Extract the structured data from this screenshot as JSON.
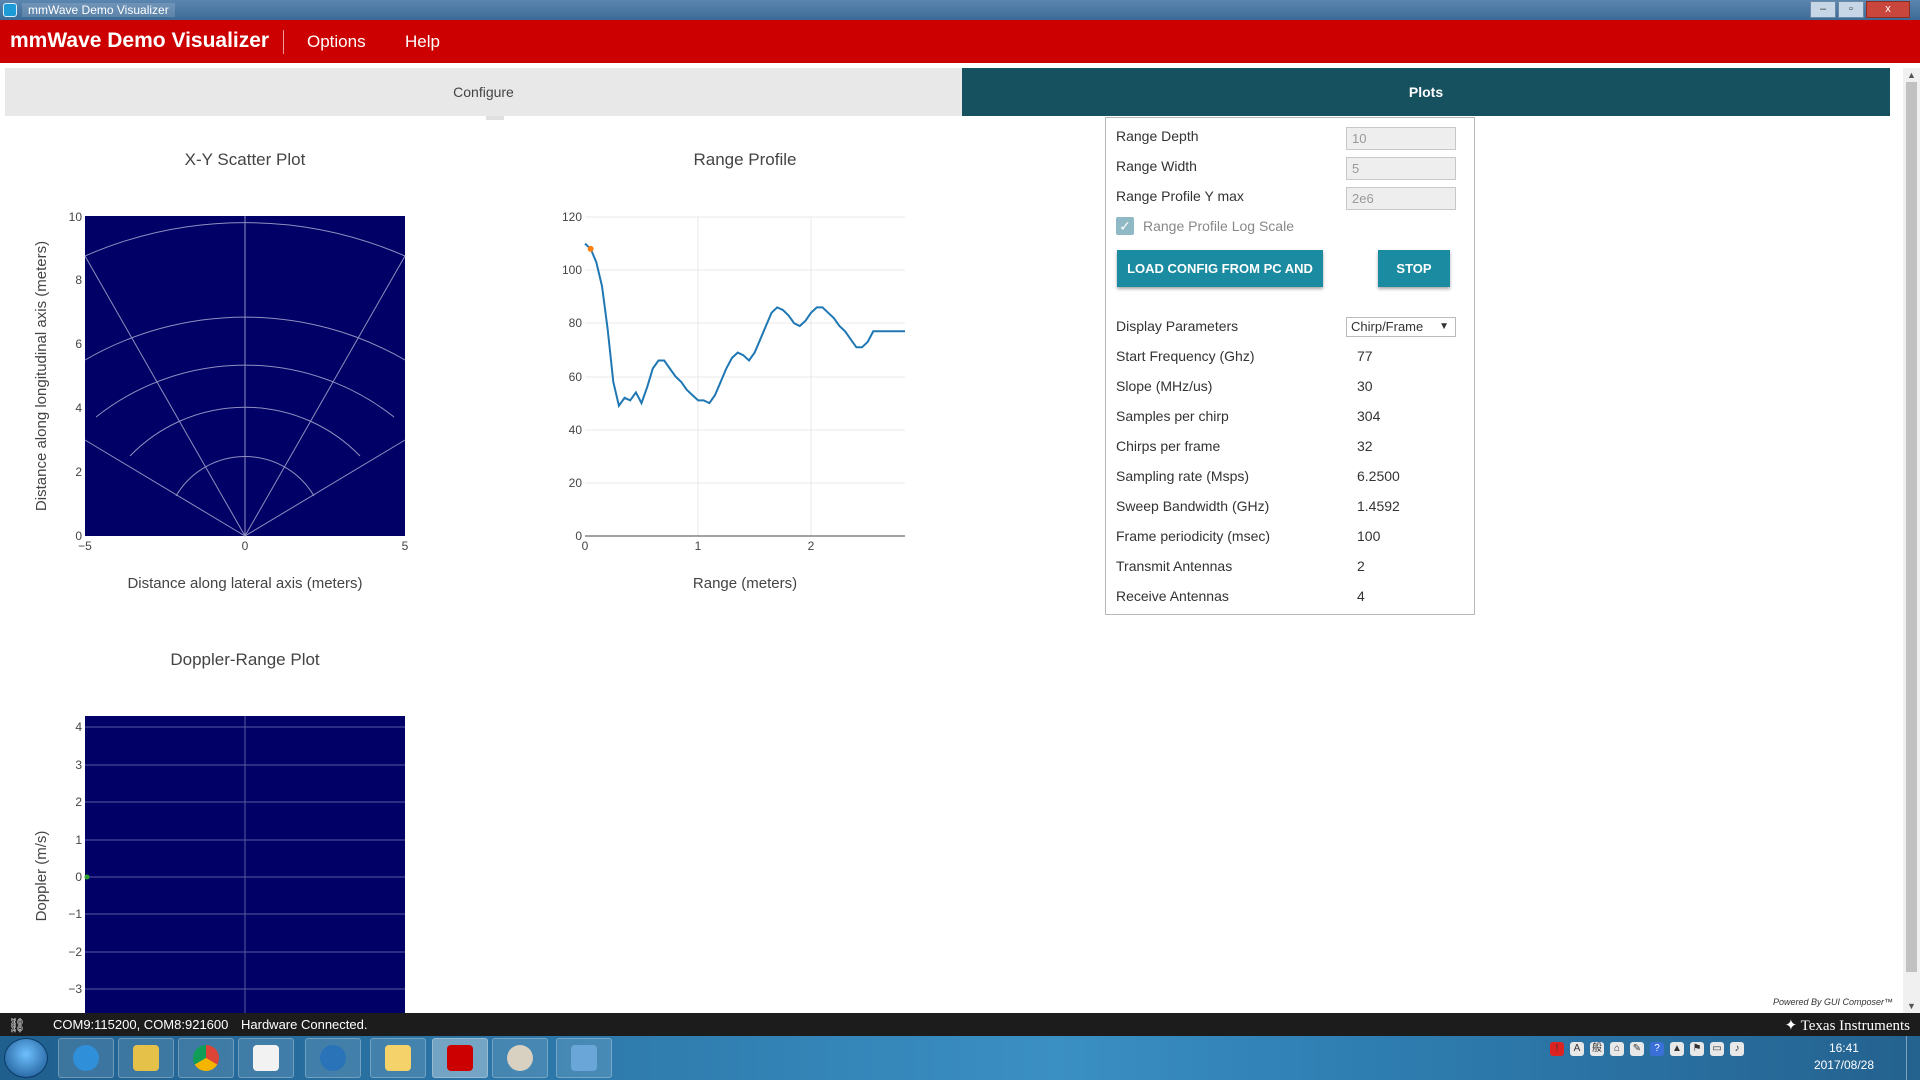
{
  "window": {
    "title": "mmWave Demo Visualizer",
    "buttons": [
      "–",
      "▫",
      "x"
    ]
  },
  "app": {
    "brand": "mmWave Demo Visualizer",
    "menu": [
      "Options",
      "Help"
    ]
  },
  "tabs": [
    {
      "label": "Configure",
      "active": false
    },
    {
      "label": "Plots",
      "active": true
    }
  ],
  "plots": {
    "scatter": {
      "title": "X-Y Scatter Plot",
      "xlabel": "Distance along lateral axis (meters)",
      "ylabel": "Distance along longitudinal axis (meters)",
      "xticks": [
        "−5",
        "0",
        "5"
      ],
      "yticks": [
        "0",
        "2",
        "4",
        "6",
        "8",
        "10"
      ],
      "background": "#000066"
    },
    "range_profile": {
      "title": "Range Profile",
      "xlabel": "Range (meters)",
      "xticks": [
        "0",
        "1",
        "2"
      ],
      "yticks": [
        "0",
        "20",
        "40",
        "60",
        "80",
        "100",
        "120"
      ],
      "line_color": "#1f77b4",
      "marker_color": "#ff7f0e"
    },
    "doppler": {
      "title": "Doppler-Range Plot",
      "ylabel": "Doppler (m/s)",
      "yticks": [
        "4",
        "3",
        "2",
        "1",
        "0",
        "−1",
        "−2",
        "−3"
      ],
      "background": "#000066"
    }
  },
  "chart_data": [
    {
      "type": "line",
      "title": "Range Profile",
      "xlabel": "Range (meters)",
      "ylabel": "",
      "xlim": [
        0,
        2.83
      ],
      "ylim": [
        0,
        120
      ],
      "x": [
        0.0,
        0.05,
        0.1,
        0.15,
        0.2,
        0.25,
        0.3,
        0.35,
        0.4,
        0.45,
        0.5,
        0.55,
        0.6,
        0.65,
        0.7,
        0.75,
        0.8,
        0.85,
        0.9,
        0.95,
        1.0,
        1.05,
        1.1,
        1.15,
        1.2,
        1.25,
        1.3,
        1.35,
        1.4,
        1.45,
        1.5,
        1.55,
        1.6,
        1.65,
        1.7,
        1.75,
        1.8,
        1.85,
        1.9,
        1.95,
        2.0,
        2.05,
        2.1,
        2.15,
        2.2,
        2.25,
        2.3,
        2.35,
        2.4,
        2.45,
        2.5,
        2.55,
        2.6,
        2.65,
        2.7,
        2.75,
        2.8,
        2.83
      ],
      "series": [
        {
          "values": [
            110,
            108,
            103,
            94,
            78,
            58,
            49,
            52,
            51,
            54,
            50,
            56,
            63,
            66,
            66,
            63,
            60,
            58,
            55,
            53,
            51,
            51,
            50,
            53,
            58,
            63,
            67,
            69,
            68,
            66,
            69,
            74,
            79,
            84,
            86,
            85,
            83,
            80,
            79,
            81,
            84,
            86,
            86,
            84,
            82,
            79,
            77,
            74,
            71,
            71,
            73,
            77,
            77,
            77,
            77,
            77,
            77,
            77
          ]
        }
      ],
      "highlight_point": {
        "x": 0.05,
        "y": 108
      }
    },
    {
      "type": "scatter",
      "title": "X-Y Scatter Plot",
      "xlabel": "Distance along lateral axis (meters)",
      "ylabel": "Distance along longitudinal axis (meters)",
      "xlim": [
        -5,
        5
      ],
      "ylim": [
        0,
        10
      ],
      "series": []
    },
    {
      "type": "scatter",
      "title": "Doppler-Range Plot",
      "xlabel": "",
      "ylabel": "Doppler (m/s)",
      "ylim": [
        -3.4,
        4.3
      ],
      "series": [
        {
          "points": [
            {
              "x": 0,
              "y": 0
            }
          ]
        }
      ]
    }
  ],
  "settings": {
    "inputs": [
      {
        "label": "Range Depth",
        "value": "10"
      },
      {
        "label": "Range Width",
        "value": "5"
      },
      {
        "label": "Range Profile Y max",
        "value": "2e6"
      }
    ],
    "log_scale": {
      "label": "Range Profile Log Scale",
      "checked": true
    },
    "buttons": {
      "load": "LOAD CONFIG FROM PC AND SEND",
      "stop": "STOP"
    },
    "display": {
      "label": "Display Parameters",
      "selected": "Chirp/Frame"
    },
    "params": [
      {
        "label": "Start Frequency (Ghz)",
        "value": "77"
      },
      {
        "label": "Slope (MHz/us)",
        "value": "30"
      },
      {
        "label": "Samples per chirp",
        "value": "304"
      },
      {
        "label": "Chirps per frame",
        "value": "32"
      },
      {
        "label": "Sampling rate (Msps)",
        "value": "6.2500"
      },
      {
        "label": "Sweep Bandwidth (GHz)",
        "value": "1.4592"
      },
      {
        "label": "Frame periodicity (msec)",
        "value": "100"
      },
      {
        "label": "Transmit Antennas",
        "value": "2"
      },
      {
        "label": "Receive Antennas",
        "value": "4"
      }
    ]
  },
  "footer": {
    "powered": "Powered By GUI Composer™"
  },
  "status": {
    "ports": "COM9:115200, COM8:921600",
    "connection": "Hardware Connected.",
    "brand": "Texas Instruments"
  },
  "taskbar": {
    "time": "16:41",
    "date": "2017/08/28"
  },
  "icons": [
    "app-icon",
    "link-icon",
    "ti-logo-icon",
    "start-icon",
    "ie-icon",
    "folder-icon",
    "chrome-icon",
    "notepad-icon",
    "globe-icon",
    "t-icon",
    "ti-app-icon",
    "paint-icon",
    "window-icon",
    "checkmark-icon",
    "caret-down-icon"
  ]
}
